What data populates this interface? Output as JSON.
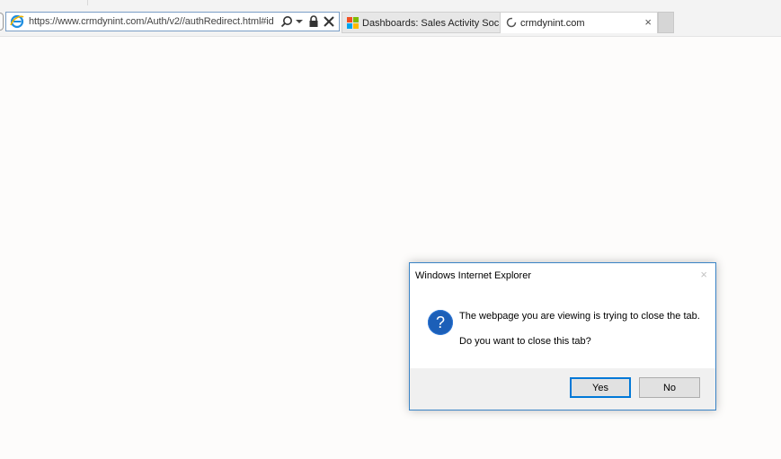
{
  "browser": {
    "address_url": "https://www.crmdynint.com/Auth/v2//authRedirect.html#id",
    "tabs": [
      {
        "label": "Dashboards: Sales Activity Soci..."
      },
      {
        "label": "crmdynint.com",
        "close": "×"
      }
    ]
  },
  "dialog": {
    "title": "Windows Internet Explorer",
    "close_glyph": "×",
    "message": "The webpage you are viewing is trying to close the tab.",
    "question": "Do you want to close this tab?",
    "yes_label": "Yes",
    "no_label": "No",
    "icon": "question-icon"
  },
  "colors": {
    "dialog_border": "#3a84c6",
    "question_icon": "#1c5fb8",
    "default_button_border": "#0078d7"
  }
}
